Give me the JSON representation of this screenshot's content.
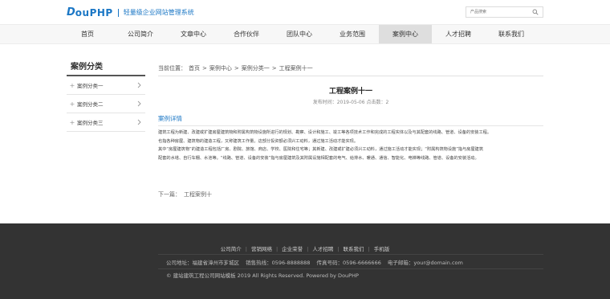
{
  "header": {
    "logo_d": "D",
    "logo_rest": "ouPHP",
    "slogan": "轻量级企业网站管理系统",
    "search_placeholder": "产品搜索"
  },
  "nav": {
    "items": [
      "首页",
      "公司简介",
      "文章中心",
      "合作伙伴",
      "团队中心",
      "业务范围",
      "案例中心",
      "人才招聘",
      "联系我们"
    ],
    "active_index": 6
  },
  "sidebar": {
    "title": "案例分类",
    "items": [
      "案例分类一",
      "案例分类二",
      "案例分类三"
    ]
  },
  "breadcrumb": {
    "label": "当前位置：",
    "items": [
      "首页",
      "案例中心",
      "案例分类一",
      "工程案例十一"
    ],
    "separator": ">"
  },
  "article": {
    "title": "工程案例十一",
    "info": "发布时间：2019-05-06 点击数：2",
    "section_label": "案例详情",
    "paragraphs": [
      "建筑工程为新建、改建或扩建房屋建筑物和附属构筑物设施所进行的规划、勘察、设计和施工、竣工等各项技术工作和完成的工程实体以及与其配套的线路、管道、设备的安装工程。",
      "也指各种房屋、建筑物的建造工程，又称建筑工作量。这部分投资额必须兴工动料，通过施工活动才能实现。",
      "其中“房屋建筑物”的建造工程包括厂房、剧院、旅馆、商店、学校、医院和住宅等；其新建、改建或扩建必须兴工动料，通过施工活动才能实现；“附属构筑物设施”指与房屋建筑",
      "配套的水塔、自行车棚、水池等。“线路、管道、设备的安装”指与房屋建筑及其附属设施相配套的电气、给排水、暖通、通信、智能化、电梯等线路、管道、设备的安装活动。"
    ],
    "next_label": "下一篇：",
    "next_title": "工程案例十"
  },
  "footer": {
    "links": [
      "公司简介",
      "营销网络",
      "企业荣誉",
      "人才招聘",
      "联系我们",
      "手机版"
    ],
    "address": "公司地址：福建省漳州市芗城区",
    "hotline": "销售热线：0596-8888888",
    "fax": "传真号码：0596-6666666",
    "email": "电子邮箱：your@domain.com",
    "copyright": "© 建站建筑工程公司网站模板 2019 All Rights Reserved. Powered by DouPHP"
  },
  "colors": {
    "brand": "#1b77c5",
    "footer_bg": "#333333",
    "nav_bg": "#f7f7f7",
    "nav_active": "#dedede"
  }
}
